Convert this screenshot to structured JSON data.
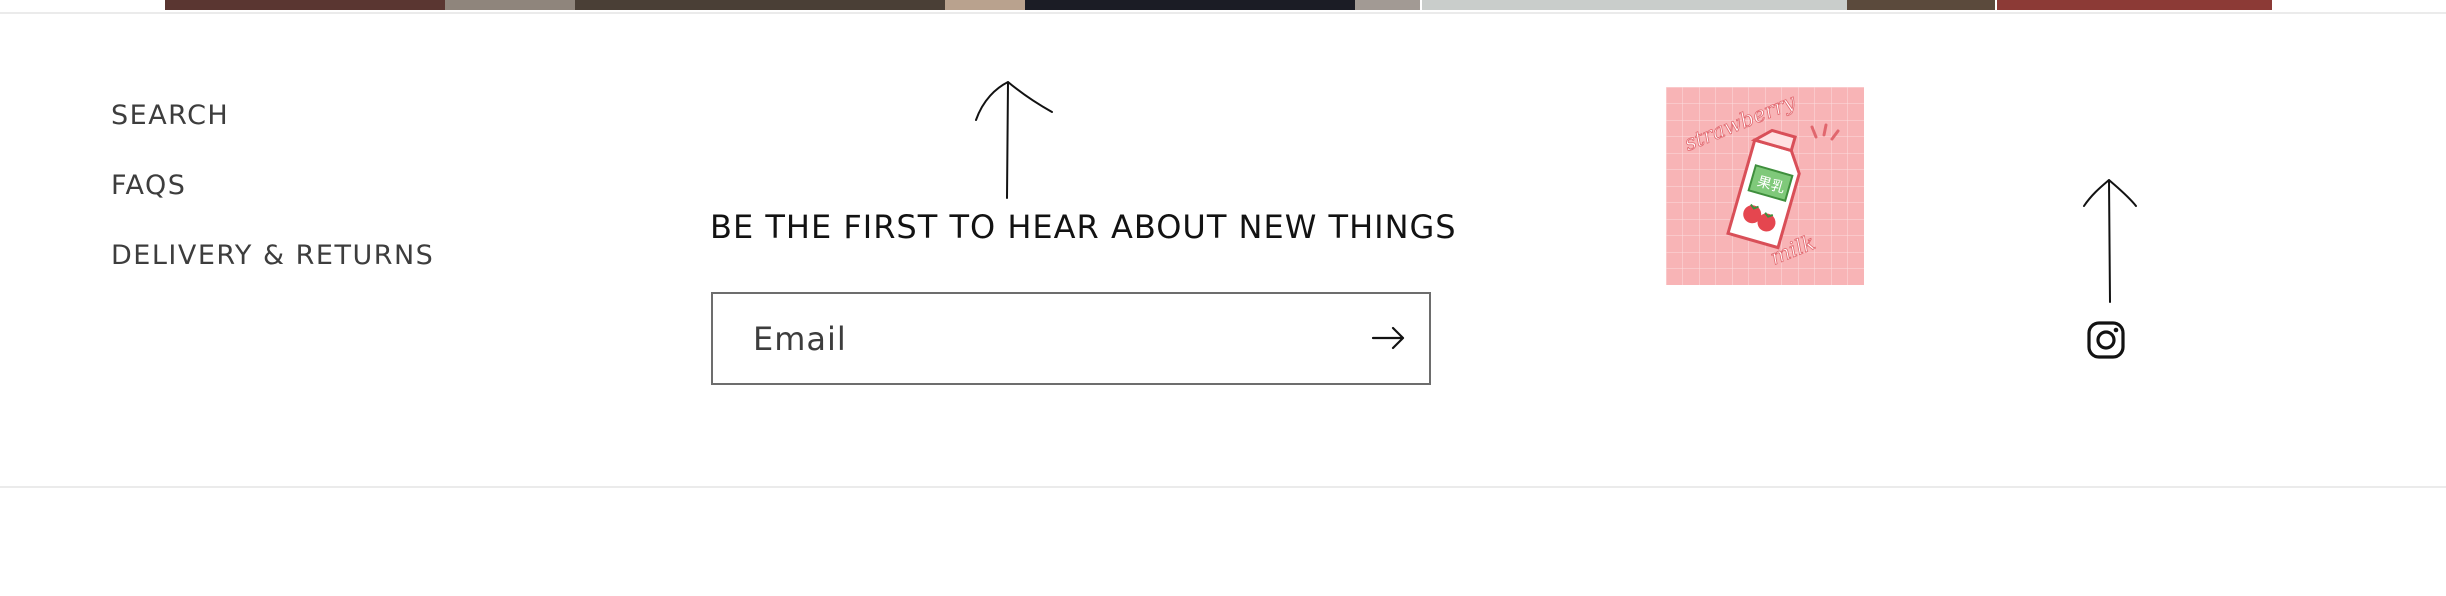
{
  "footer": {
    "links": [
      {
        "label": "SEARCH"
      },
      {
        "label": "FAQS"
      },
      {
        "label": "DELIVERY & RETURNS"
      }
    ]
  },
  "newsletter": {
    "heading": "BE THE FIRST TO HEAR ABOUT NEW THINGS",
    "email_placeholder": "Email",
    "submit_icon": "arrow-right-icon"
  },
  "logo": {
    "text_top": "strawberry",
    "text_bottom": "milk",
    "carton_text": "果乳"
  },
  "social": {
    "instagram_icon": "instagram-icon"
  },
  "colors": {
    "text": "#121212",
    "link_text": "#3d3d3d",
    "border": "#6d6d6d",
    "divider": "#ebebeb",
    "logo_background": "#f8b4b6"
  }
}
